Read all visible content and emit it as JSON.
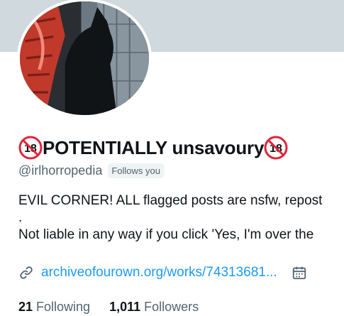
{
  "profile": {
    "display_name": "POTENTIALLY unsavoury",
    "handle": "@irlhorropedia",
    "follows_you_label": "Follows you",
    "bio_lines": [
      "EVIL CORNER! ALL flagged posts are nsfw, repost",
      ".",
      "Not liable in any way if you click 'Yes, I'm over the"
    ],
    "link_text": "archiveofourown.org/works/74313681...",
    "stats": {
      "following_count": "21",
      "following_label": "Following",
      "followers_count": "1,011",
      "followers_label": "Followers"
    }
  },
  "icons": {
    "badge": "no-under-18-icon",
    "link": "link-icon",
    "calendar": "calendar-icon"
  },
  "colors": {
    "banner": "#cfd9de",
    "link": "#1d9bf0",
    "secondary_text": "#536471",
    "badge_red": "#e0243a"
  }
}
